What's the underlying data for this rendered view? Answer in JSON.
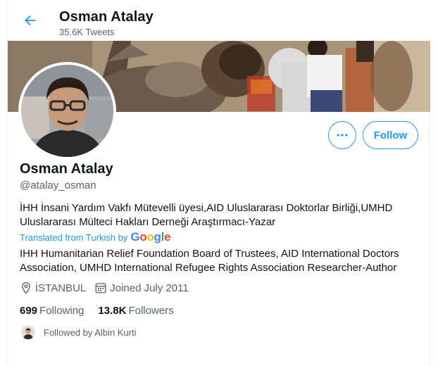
{
  "header": {
    "title": "Osman Atalay",
    "tweet_count": "35.6K Tweets"
  },
  "profile": {
    "name": "Osman Atalay",
    "handle": "@atalay_osman",
    "bio_original": "İHH İnsani Yardım Vakfı Mütevelli üyesi,AID Uluslararası Doktorlar Birliği,UMHD Uluslararası Mülteci Hakları Derneği Araştırmacı-Yazar",
    "translated_label": "Translated from Turkish by",
    "translator": "Google",
    "bio_translated": "IHH Humanitarian Relief Foundation Board of Trustees, AID International Doctors Association, UMHD International Refugee Rights Association Researcher-Author",
    "location": "İSTANBUL",
    "joined": "Joined July 2011",
    "following_count": "699",
    "following_label": "Following",
    "followers_count": "13.8K",
    "followers_label": "Followers",
    "followed_by": "Followed by Albin Kurti"
  },
  "actions": {
    "follow_label": "Follow"
  },
  "colors": {
    "accent": "#1d9bf0",
    "text_primary": "#0f1419",
    "text_secondary": "#536471",
    "google_blue": "#4285F4",
    "google_red": "#EA4335",
    "google_yellow": "#FBBC05",
    "google_green": "#34A853"
  },
  "icons": {
    "back": "arrow-left-icon",
    "more": "more-horizontal-icon",
    "location": "location-pin-icon",
    "calendar": "calendar-icon"
  }
}
